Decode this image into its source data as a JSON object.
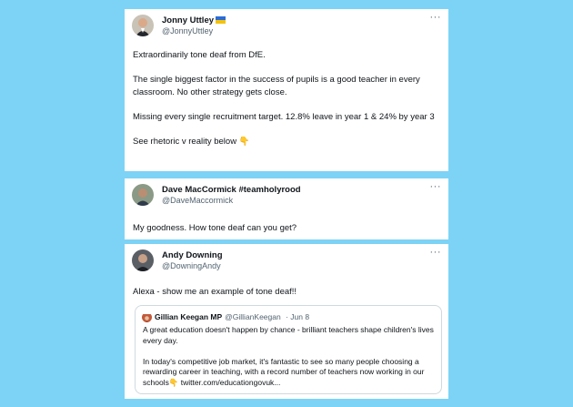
{
  "tweets": [
    {
      "name": "Jonny Uttley",
      "handle": "@JonnyUttley",
      "has_flag": true,
      "paragraphs": [
        "Extraordinarily tone deaf from DfE.",
        "The single biggest factor in the success of pupils is a good teacher in every classroom. No other strategy gets close.",
        "Missing every single recruitment target. 12.8% leave in year 1 & 24% by year 3",
        "See rhetoric v reality below"
      ],
      "emoji": "👇"
    },
    {
      "name": "Dave MacCormick #teamholyrood",
      "handle": "@DaveMaccormick",
      "paragraphs": [
        "My goodness. How tone deaf can you get?"
      ]
    },
    {
      "name": "Andy Downing",
      "handle": "@DowningAndy",
      "paragraphs": [
        "Alexa - show me an example of tone deaf!!"
      ],
      "quote": {
        "name": "Gillian Keegan MP",
        "handle": "@GillianKeegan",
        "date": "· Jun 8",
        "paragraphs": [
          "A great education doesn't happen by chance - brilliant teachers shape children's lives every day.",
          "In today's competitive job market, it's fantastic to see so many people choosing a rewarding career in teaching, with a record number of teachers now working in our schools👇 twitter.com/educationgovuk..."
        ]
      }
    }
  ],
  "more_icon": "more-horizontal-icon",
  "colors": {
    "background": "#7dd3f5",
    "card": "#ffffff",
    "text": "#0f1419",
    "muted": "#536471",
    "border": "#cfd9de"
  }
}
